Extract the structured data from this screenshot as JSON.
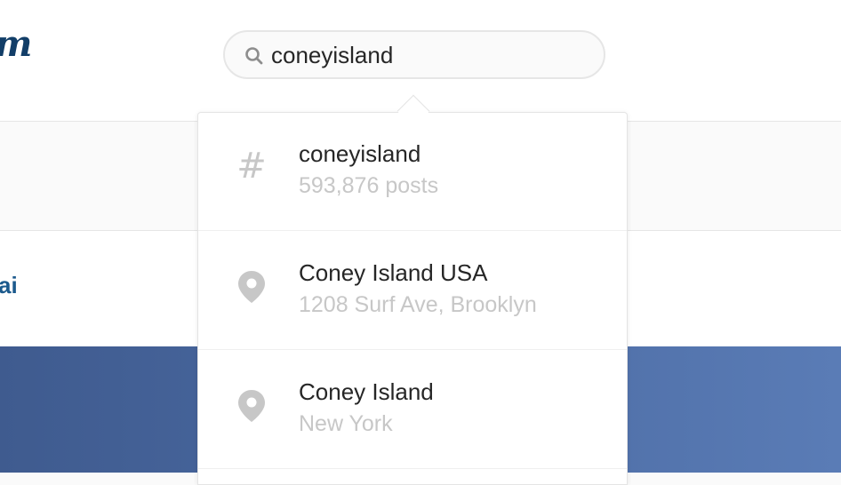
{
  "header": {
    "logo_fragment": "m",
    "search": {
      "value": "coneyisland",
      "icon": "search-icon"
    }
  },
  "background": {
    "profile_fragment": "ai"
  },
  "dropdown": {
    "results": [
      {
        "icon": "hashtag-icon",
        "title": "coneyisland",
        "subtitle": "593,876 posts"
      },
      {
        "icon": "location-pin-icon",
        "title": "Coney Island USA",
        "subtitle": "1208 Surf Ave, Brooklyn"
      },
      {
        "icon": "location-pin-icon",
        "title": "Coney Island",
        "subtitle": "New York"
      }
    ]
  },
  "colors": {
    "brand_text": "#123e68",
    "link_text": "#1c5a8d",
    "muted_text": "#c7c7c7",
    "primary_text": "#262626",
    "photo_blue": "#4b6aa2"
  }
}
